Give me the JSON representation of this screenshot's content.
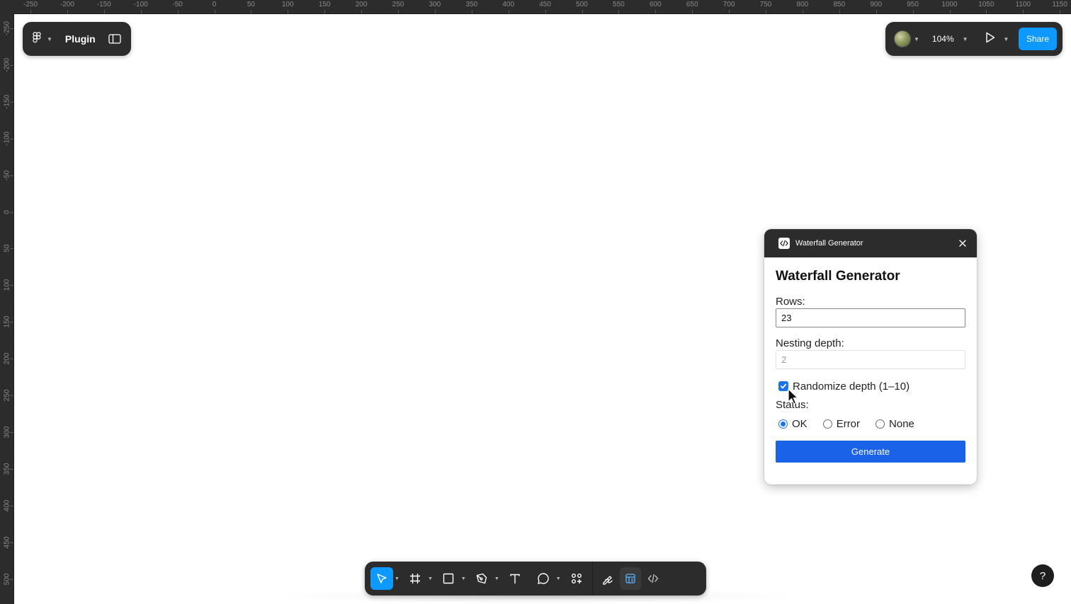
{
  "rulers": {
    "top_ticks": [
      "-250",
      "-200",
      "-150",
      "-100",
      "-50",
      "0",
      "50",
      "100",
      "150",
      "200",
      "250",
      "300",
      "350",
      "400",
      "450",
      "500",
      "550",
      "600",
      "650",
      "700",
      "750",
      "800",
      "850",
      "900",
      "950",
      "1000",
      "1050",
      "1100",
      "1150"
    ],
    "left_ticks": [
      "-250",
      "-200",
      "-150",
      "-100",
      "-50",
      "0",
      "50",
      "100",
      "150",
      "200",
      "250",
      "300",
      "350",
      "400",
      "450",
      "500"
    ]
  },
  "file_menu": {
    "logo_icon": "figma-logo-icon",
    "title": "Plugin",
    "sidebar_icon": "sidebar-toggle-icon"
  },
  "top_right": {
    "avatar_icon": "user-avatar",
    "zoom_label": "104%",
    "present_icon": "play-icon",
    "share_label": "Share"
  },
  "plugin": {
    "window_title": "Waterfall Generator",
    "heading": "Waterfall Generator",
    "rows_label": "Rows:",
    "rows_value": "23",
    "depth_label": "Nesting depth:",
    "depth_value": "2",
    "randomize_label": "Randomize depth (1–10)",
    "randomize_checked": true,
    "status_label": "Status:",
    "status_options": [
      "OK",
      "Error",
      "None"
    ],
    "status_selected": "OK",
    "generate_label": "Generate"
  },
  "toolbar": {
    "tools": [
      "move-icon",
      "frame-icon",
      "rectangle-icon",
      "pen-icon",
      "text-icon",
      "comment-icon",
      "components-icon"
    ],
    "modes": [
      "draw-mode-icon",
      "design-mode-icon",
      "dev-mode-icon"
    ]
  },
  "help": {
    "label": "?"
  },
  "colors": {
    "chrome": "#2c2c2c",
    "accent": "#0d99ff",
    "plugin_button": "#1a62e8",
    "checkbox": "#1a73e8"
  }
}
